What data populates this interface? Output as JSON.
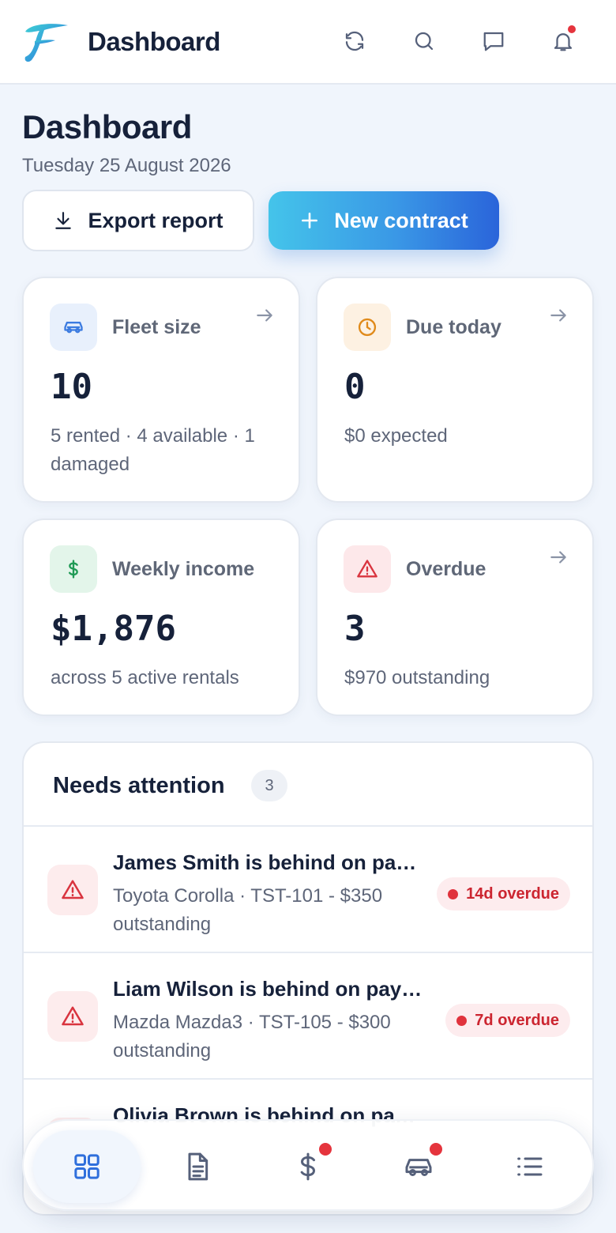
{
  "app": {
    "title": "Dashboard"
  },
  "header": {
    "title": "Dashboard",
    "date": "Tuesday 25 August 2026",
    "export_label": "Export report",
    "new_label": "New contract"
  },
  "stats": [
    {
      "label": "Fleet size",
      "value": "10",
      "sub": "5 rented · 4 available · 1 damaged",
      "icon": "car-icon",
      "color": "#3b7be0"
    },
    {
      "label": "Due today",
      "value": "0",
      "sub": "$0 expected",
      "icon": "clock-icon",
      "color": "#e08a1a"
    },
    {
      "label": "Weekly income",
      "value": "$1,876",
      "sub": "across 5 active rentals",
      "icon": "dollar-icon",
      "color": "#1f9a55"
    },
    {
      "label": "Overdue",
      "value": "3",
      "sub": "$970 outstanding",
      "icon": "warning-icon",
      "color": "#d9343f"
    }
  ],
  "attention": {
    "title": "Needs attention",
    "count": "3",
    "items": [
      {
        "title": "James Smith is behind on pa…",
        "sub": "Toyota Corolla · TST-101 - $350 outstanding",
        "badge": "14d overdue"
      },
      {
        "title": "Liam Wilson is behind on pay…",
        "sub": "Mazda Mazda3 · TST-105 - $300 outstanding",
        "badge": "7d overdue"
      },
      {
        "title": "Olivia Brown is behind on pa…",
        "sub": "",
        "badge": ""
      }
    ]
  },
  "nav": {
    "items": [
      "grid-icon",
      "document-icon",
      "dollar-icon",
      "car-icon",
      "list-icon"
    ],
    "active": "grid-icon"
  },
  "colors": {
    "accent_start": "#44c4ea",
    "accent_end": "#2a64da",
    "danger": "#e5343d"
  }
}
